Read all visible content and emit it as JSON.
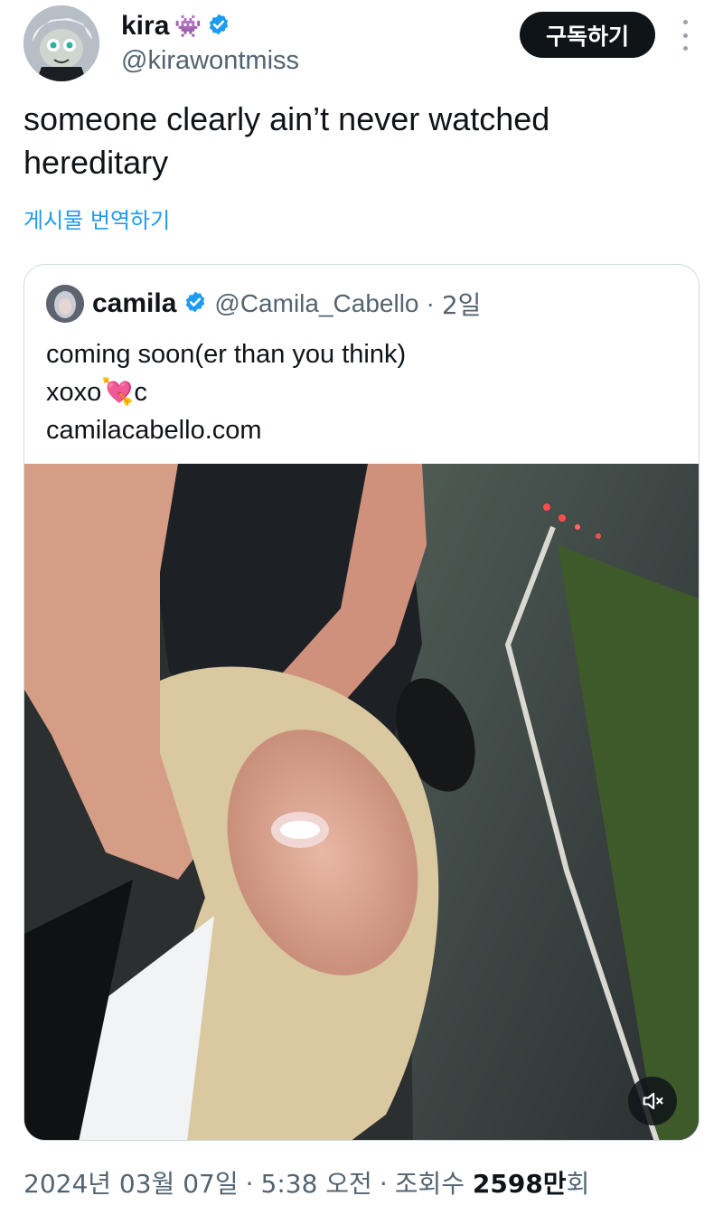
{
  "author": {
    "display_name": "kira",
    "emoji": "👾",
    "handle": "@kirawontmiss",
    "verified": true
  },
  "follow_button_label": "구독하기",
  "tweet_text": "someone clearly ain’t never watched\nhereditary",
  "translate_label": "게시물 번역하기",
  "quote": {
    "display_name": "camila",
    "handle": "@Camila_Cabello",
    "separator": "·",
    "age": "2일",
    "text": "coming soon(er than you think)\nxoxo💘c\ncamilacabello.com",
    "media": {
      "type": "video",
      "muted": true,
      "mute_icon": "volume-muted-icon"
    }
  },
  "footer": {
    "date": "2024년 03월 07일",
    "sep1": "·",
    "time": "5:38 오전",
    "sep2": "·",
    "views_label": "조회수",
    "views_count": "2598만",
    "views_suffix": "회"
  },
  "colors": {
    "accent": "#1d9bf0",
    "text": "#0f1419",
    "secondary": "#536471",
    "border": "#cfd9de"
  }
}
